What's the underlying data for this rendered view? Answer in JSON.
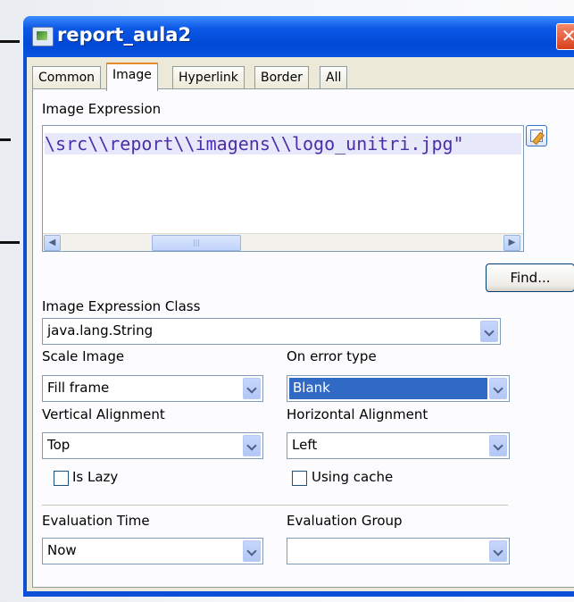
{
  "window": {
    "title": "report_aula2"
  },
  "tabs": [
    {
      "label": "Common",
      "active": false
    },
    {
      "label": "Image",
      "active": true
    },
    {
      "label": "Hyperlink",
      "active": false
    },
    {
      "label": "Border",
      "active": false
    },
    {
      "label": "All",
      "active": false
    }
  ],
  "image_expression": {
    "label": "Image Expression",
    "value": "\\src\\\\report\\\\imagens\\\\logo_unitri.jpg\""
  },
  "find_button": {
    "label": "Find..."
  },
  "image_expression_class": {
    "label": "Image Expression Class",
    "value": "java.lang.String"
  },
  "scale_image": {
    "label": "Scale Image",
    "value": "Fill frame"
  },
  "on_error_type": {
    "label": "On error type",
    "value": "Blank"
  },
  "vertical_alignment": {
    "label": "Vertical Alignment",
    "value": "Top"
  },
  "horizontal_alignment": {
    "label": "Horizontal Alignment",
    "value": "Left"
  },
  "is_lazy": {
    "label": "Is Lazy",
    "checked": false
  },
  "using_cache": {
    "label": "Using cache",
    "checked": false
  },
  "evaluation_time": {
    "label": "Evaluation Time",
    "value": "Now"
  },
  "evaluation_group": {
    "label": "Evaluation Group",
    "value": ""
  },
  "colors": {
    "titlebar": "#0a54e0",
    "selection": "#316ac5",
    "dialog_bg": "#ece9d8"
  }
}
